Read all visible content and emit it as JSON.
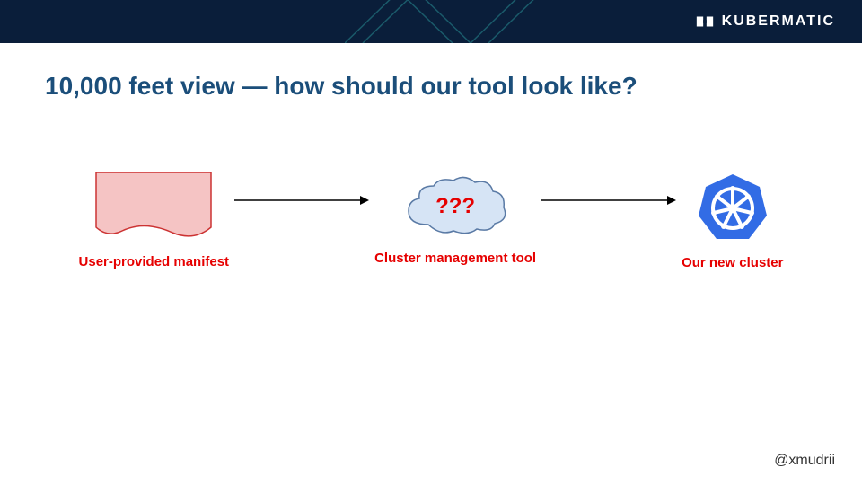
{
  "header": {
    "brand": "KUBERMATIC"
  },
  "title": "10,000 feet view — how should our tool look like?",
  "diagram": {
    "node1_label": "User-provided manifest",
    "node2_label": "Cluster management tool",
    "node2_text": "???",
    "node3_label": "Our new cluster"
  },
  "footer": {
    "handle": "@xmudrii"
  },
  "colors": {
    "header_bg": "#0a1e3a",
    "title_color": "#1b4e7a",
    "label_red": "#e60000",
    "manifest_fill": "#f5c4c4",
    "cloud_fill": "#d6e4f5",
    "k8s_blue": "#326ce5"
  }
}
